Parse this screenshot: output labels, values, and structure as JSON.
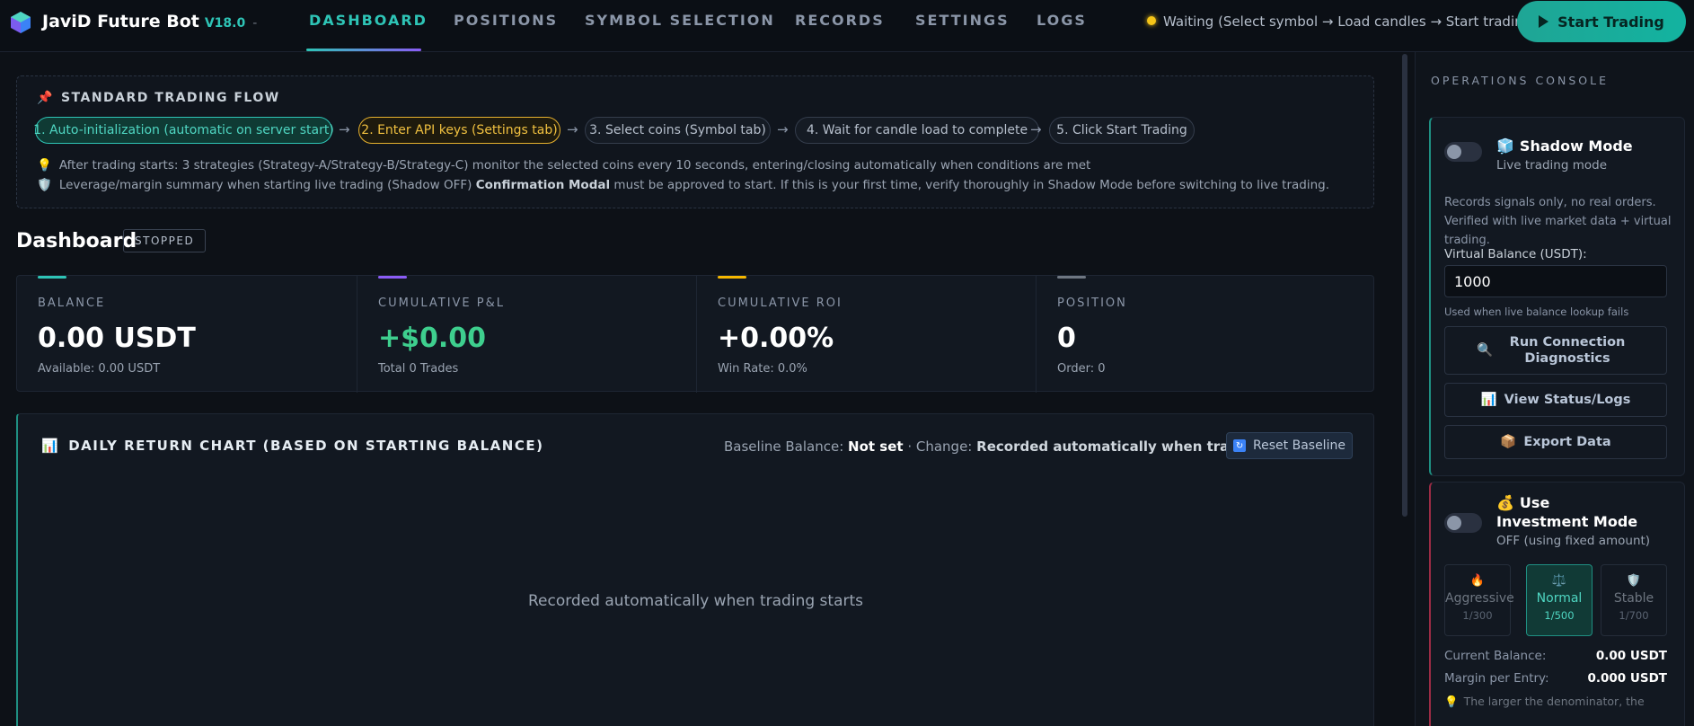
{
  "header": {
    "brand": "JaviD Future Bot",
    "version": "V18.0",
    "separator": "-",
    "tabs": [
      {
        "label": "DASHBOARD",
        "active": true
      },
      {
        "label": "POSITIONS"
      },
      {
        "label": "SYMBOL SELECTION"
      },
      {
        "label": "RECORDS"
      },
      {
        "label": "SETTINGS"
      },
      {
        "label": "LOGS"
      }
    ],
    "status_text": "Waiting (Select symbol → Load candles → Start trading)",
    "status_color": "#f5c518",
    "start_button": "Start Trading",
    "accent": "#2ec4b6"
  },
  "flow": {
    "title": "STANDARD TRADING FLOW",
    "title_icon": "pushpin-icon",
    "steps": [
      "1. Auto-initialization (automatic on server start)",
      "2. Enter API keys (Settings tab)",
      "3. Select coins (Symbol tab)",
      "4. Wait for candle load to complete",
      "5. Click Start Trading"
    ],
    "arrow": "→",
    "note1": "After trading starts: 3 strategies (Strategy-A/Strategy-B/Strategy-C) monitor the selected coins every 10 seconds, entering/closing automatically when conditions are met",
    "note2_pre": "Leverage/margin summary when starting live trading (Shadow OFF)",
    "note2_bold": "Confirmation Modal",
    "note2_post": "must be approved to start. If this is your first time, verify thoroughly in Shadow Mode before switching to live trading."
  },
  "dashboard": {
    "title": "Dashboard",
    "status_badge": "STOPPED",
    "stats": [
      {
        "label": "BALANCE",
        "value": "0.00 USDT",
        "sub": "Available: 0.00 USDT",
        "color": "#2ec4b6"
      },
      {
        "label": "CUMULATIVE P&L",
        "value": "+$0.00",
        "sub": "Total 0 Trades",
        "color": "#8b5cf6"
      },
      {
        "label": "CUMULATIVE ROI",
        "value": "+0.00%",
        "sub": "Win Rate: 0.0%",
        "color": "#f5b700"
      },
      {
        "label": "POSITION",
        "value": "0",
        "sub": "Order: 0",
        "color": "#6e7681"
      }
    ]
  },
  "chart": {
    "title": "DAILY RETURN CHART (BASED ON STARTING BALANCE)",
    "baseline_label": "Baseline Balance:",
    "baseline_value": "Not set",
    "change_label": "· Change:",
    "change_value": "Recorded automatically when trading starts",
    "reset_button": "Reset Baseline",
    "empty_message": "Recorded automatically when trading starts"
  },
  "sidebar": {
    "heading": "OPERATIONS CONSOLE",
    "shadow": {
      "title": "Shadow Mode",
      "subtitle": "Live trading mode",
      "description": "Records signals only, no real orders. Verified with live market data + virtual trading.",
      "balance_label": "Virtual Balance (USDT):",
      "balance_value": "1000",
      "balance_hint": "Used when live balance lookup fails",
      "btn_diagnostics": "Run Connection Diagnostics",
      "btn_status": "View Status/Logs",
      "btn_export": "Export Data",
      "enabled": false
    },
    "invest": {
      "title": "Use Investment Mode",
      "subtitle": "OFF (using fixed amount)",
      "enabled": false,
      "modes": [
        {
          "name": "Aggressive",
          "ratio": "1/300",
          "icon": "fire-icon"
        },
        {
          "name": "Normal",
          "ratio": "1/500",
          "icon": "scale-icon",
          "active": true
        },
        {
          "name": "Stable",
          "ratio": "1/700",
          "icon": "shield-icon"
        }
      ],
      "current_balance_label": "Current Balance:",
      "current_balance_value": "0.00 USDT",
      "margin_label": "Margin per Entry:",
      "margin_value": "0.000 USDT",
      "note": "The larger the denominator, the"
    }
  }
}
